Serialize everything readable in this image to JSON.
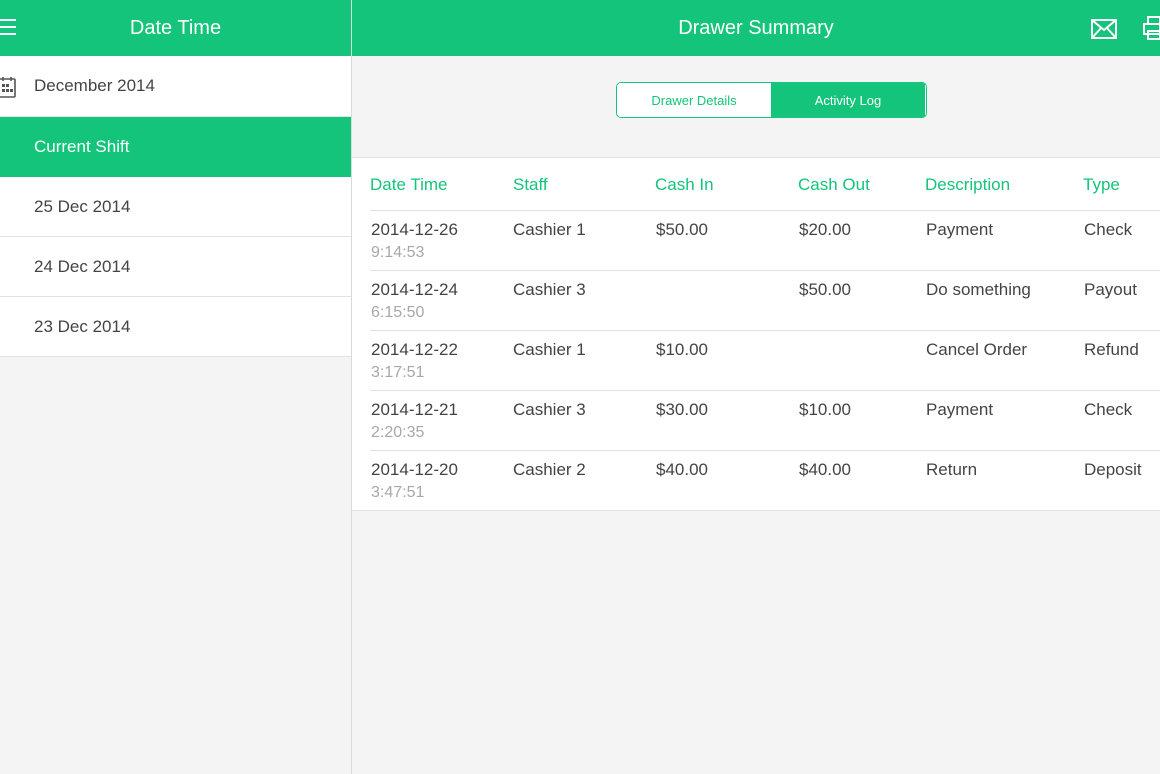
{
  "left": {
    "title": "Date Time",
    "items": [
      {
        "label": "December 2014"
      },
      {
        "label": "Current Shift"
      },
      {
        "label": "25 Dec 2014"
      },
      {
        "label": "24 Dec 2014"
      },
      {
        "label": "23 Dec 2014"
      }
    ]
  },
  "right": {
    "title": "Drawer Summary",
    "segment": {
      "details": "Drawer Details",
      "log": "Activity Log",
      "selected": "Activity Log"
    }
  },
  "table": {
    "columns": [
      "Date Time",
      "Staff",
      "Cash In",
      "Cash Out",
      "Description",
      "Type"
    ],
    "rows": [
      {
        "date": "2014-12-26",
        "time": "9:14:53",
        "staff": "Cashier 1",
        "cash_in": "$50.00",
        "cash_out": "$20.00",
        "description": "Payment",
        "type": "Check"
      },
      {
        "date": "2014-12-24",
        "time": "6:15:50",
        "staff": "Cashier 3",
        "cash_in": "",
        "cash_out": "$50.00",
        "description": "Do something",
        "type": "Payout"
      },
      {
        "date": "2014-12-22",
        "time": "3:17:51",
        "staff": "Cashier 1",
        "cash_in": "$10.00",
        "cash_out": "",
        "description": "Cancel Order",
        "type": "Refund"
      },
      {
        "date": "2014-12-21",
        "time": "2:20:35",
        "staff": "Cashier 3",
        "cash_in": "$30.00",
        "cash_out": "$10.00",
        "description": "Payment",
        "type": "Check"
      },
      {
        "date": "2014-12-20",
        "time": "3:47:51",
        "staff": "Cashier 2",
        "cash_in": "$40.00",
        "cash_out": "$40.00",
        "description": "Return",
        "type": "Deposit"
      }
    ]
  },
  "icons": {
    "menu": "menu-icon",
    "calendar": "calendar-icon",
    "mail": "mail-icon",
    "print": "print-icon"
  },
  "colors": {
    "accent": "#14c47a",
    "text": "#444444",
    "muted": "#a8a8a8",
    "background": "#f4f4f4"
  }
}
